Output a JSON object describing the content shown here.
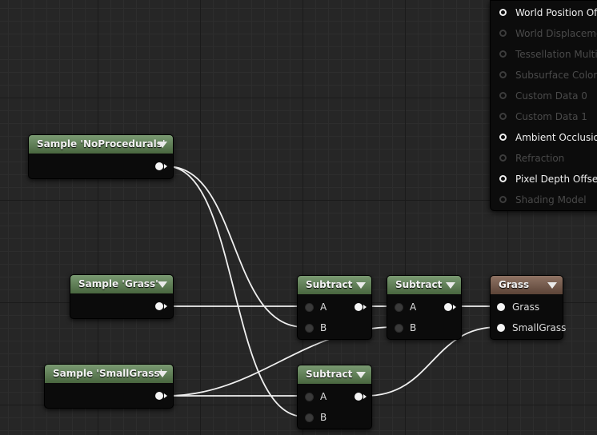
{
  "result_node": {
    "inputs": [
      {
        "label": "World Position Offset",
        "active": true
      },
      {
        "label": "World Displacement",
        "active": false
      },
      {
        "label": "Tessellation Multiplier",
        "active": false
      },
      {
        "label": "Subsurface Color",
        "active": false
      },
      {
        "label": "Custom Data 0",
        "active": false
      },
      {
        "label": "Custom Data 1",
        "active": false
      },
      {
        "label": "Ambient Occlusion",
        "active": true
      },
      {
        "label": "Refraction",
        "active": false
      },
      {
        "label": "Pixel Depth Offset",
        "active": true
      },
      {
        "label": "Shading Model",
        "active": false
      }
    ]
  },
  "nodes": {
    "sample_noprocedurals": {
      "title": "Sample 'NoProcedurals'"
    },
    "sample_grass": {
      "title": "Sample 'Grass'"
    },
    "sample_smallgrass": {
      "title": "Sample 'SmallGrass'"
    },
    "subtract_1": {
      "title": "Subtract",
      "input_a": "A",
      "input_b": "B"
    },
    "subtract_2": {
      "title": "Subtract",
      "input_a": "A",
      "input_b": "B"
    },
    "subtract_3": {
      "title": "Subtract",
      "input_a": "A",
      "input_b": "B"
    },
    "grass_output": {
      "title": "Grass",
      "input_1": "Grass",
      "input_2": "SmallGrass"
    }
  },
  "colors": {
    "canvas": "#262626",
    "sample_header": "#5f7d56",
    "grass_header": "#765a4c",
    "wire": "#f0f0f0",
    "active_pin": "#f5f5f5",
    "inactive_text": "#4a4a4a"
  }
}
